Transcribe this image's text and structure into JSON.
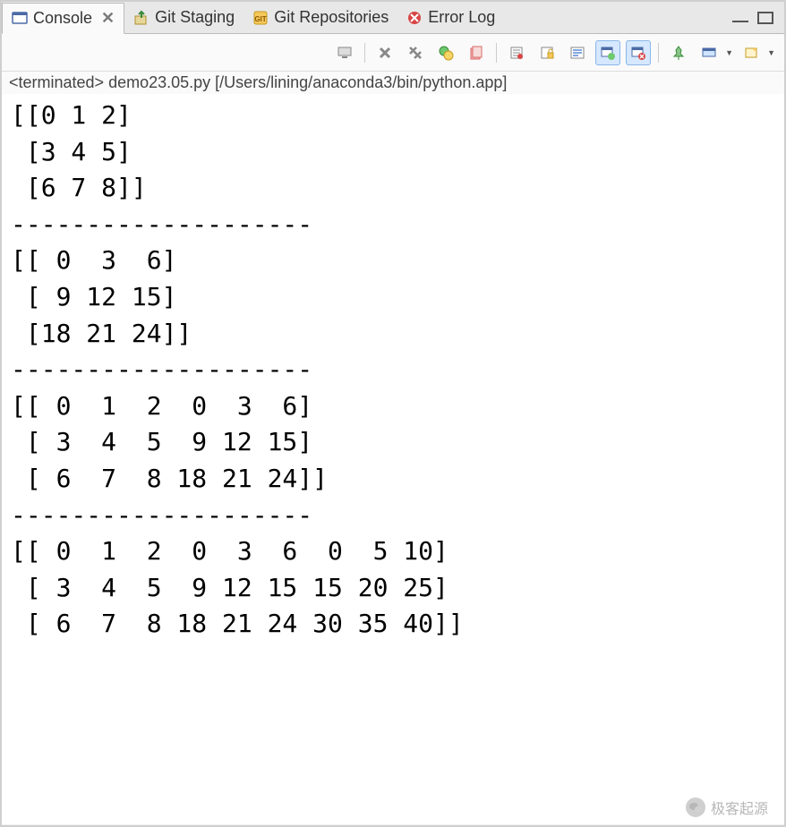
{
  "tabs": [
    {
      "label": "Console",
      "active": true,
      "closable": true,
      "icon": "console-icon"
    },
    {
      "label": "Git Staging",
      "active": false,
      "closable": false,
      "icon": "git-staging-icon"
    },
    {
      "label": "Git Repositories",
      "active": false,
      "closable": false,
      "icon": "git-repo-icon"
    },
    {
      "label": "Error Log",
      "active": false,
      "closable": false,
      "icon": "error-log-icon"
    }
  ],
  "status": "<terminated> demo23.05.py [/Users/lining/anaconda3/bin/python.app]",
  "output": "[[0 1 2]\n [3 4 5]\n [6 7 8]]\n--------------------\n[[ 0  3  6]\n [ 9 12 15]\n [18 21 24]]\n--------------------\n[[ 0  1  2  0  3  6]\n [ 3  4  5  9 12 15]\n [ 6  7  8 18 21 24]]\n--------------------\n[[ 0  1  2  0  3  6  0  5 10]\n [ 3  4  5  9 12 15 15 20 25]\n [ 6  7  8 18 21 24 30 35 40]]",
  "watermark": "极客起源",
  "toolbar_icons": {
    "computer": "computer-icon",
    "remove": "remove-launch-icon",
    "remove_all": "remove-all-icon",
    "terminate": "terminate-icon",
    "clear": "clear-icon",
    "scroll_lock": "scroll-lock-icon",
    "lock": "lock-icon",
    "word_wrap": "word-wrap-icon",
    "show_std": "show-std-icon",
    "show_err": "show-err-icon",
    "pin": "pin-icon",
    "display": "display-icon",
    "new": "new-console-icon"
  }
}
